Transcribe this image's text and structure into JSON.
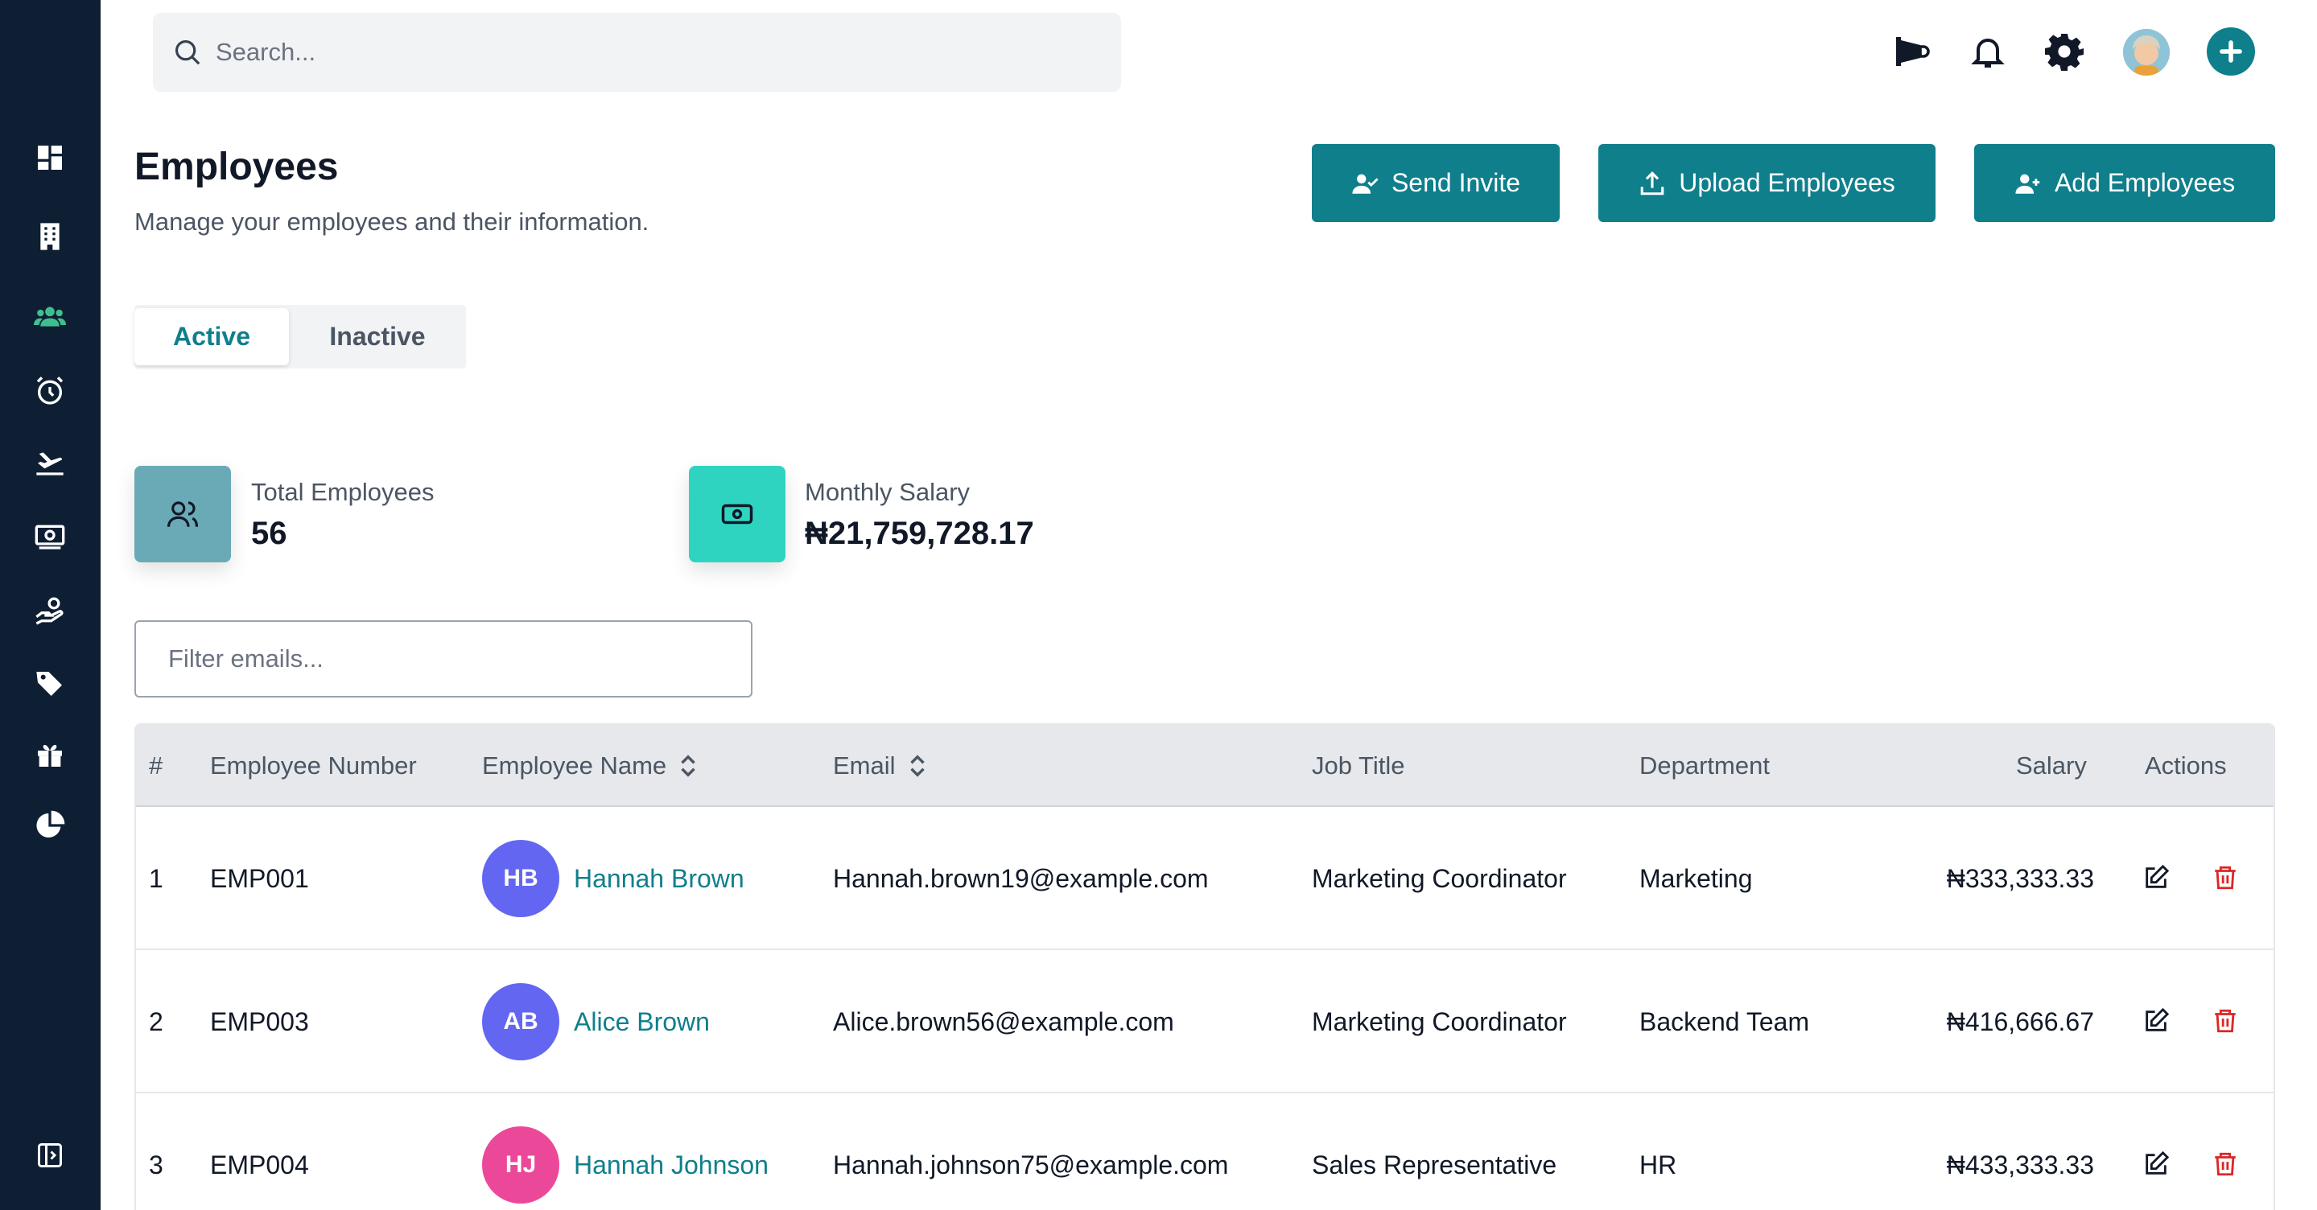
{
  "search": {
    "placeholder": "Search..."
  },
  "header": {
    "title": "Employees",
    "subtitle": "Manage your employees and their information."
  },
  "actions": {
    "send_invite": "Send Invite",
    "upload_employees": "Upload Employees",
    "add_employees": "Add Employees"
  },
  "tabs": {
    "active": "Active",
    "inactive": "Inactive"
  },
  "stats": {
    "total_label": "Total Employees",
    "total_value": "56",
    "salary_label": "Monthly Salary",
    "salary_value": "₦21,759,728.17"
  },
  "filter": {
    "placeholder": "Filter emails..."
  },
  "table": {
    "columns": {
      "num": "#",
      "employee_number": "Employee Number",
      "employee_name": "Employee Name",
      "email": "Email",
      "job_title": "Job Title",
      "department": "Department",
      "salary": "Salary",
      "actions": "Actions"
    },
    "rows": [
      {
        "num": "1",
        "employee_number": "EMP001",
        "initials": "HB",
        "name": "Hannah Brown",
        "email": "Hannah.brown19@example.com",
        "job_title": "Marketing Coordinator",
        "department": "Marketing",
        "salary": "₦333,333.33"
      },
      {
        "num": "2",
        "employee_number": "EMP003",
        "initials": "AB",
        "name": "Alice Brown",
        "email": "Alice.brown56@example.com",
        "job_title": "Marketing Coordinator",
        "department": "Backend Team",
        "salary": "₦416,666.67"
      },
      {
        "num": "3",
        "employee_number": "EMP004",
        "initials": "HJ",
        "name": "Hannah Johnson",
        "email": "Hannah.johnson75@example.com",
        "job_title": "Sales Representative",
        "department": "HR",
        "salary": "₦433,333.33"
      }
    ]
  },
  "colors": {
    "sidebar": "#0e1f33",
    "primary": "#0f7f8c",
    "sidebar_active": "#3fbf8f",
    "total_icon_bg": "#6aaab7",
    "salary_icon_bg": "#2fd4c0",
    "avatar_hb": "#6366f1",
    "avatar_ab": "#6366f1",
    "avatar_hj": "#ec4899",
    "delete": "#dc2626"
  },
  "icons": {
    "sidebar": [
      "dashboard-icon",
      "building-icon",
      "users-icon",
      "alarm-clock-icon",
      "plane-icon",
      "money-icon",
      "hand-coin-icon",
      "tags-icon",
      "gift-icon",
      "pie-chart-icon",
      "sidebar-collapse-icon"
    ],
    "topbar": [
      "megaphone-icon",
      "bell-icon",
      "gear-icon",
      "user-avatar",
      "plus-circle-icon"
    ]
  }
}
